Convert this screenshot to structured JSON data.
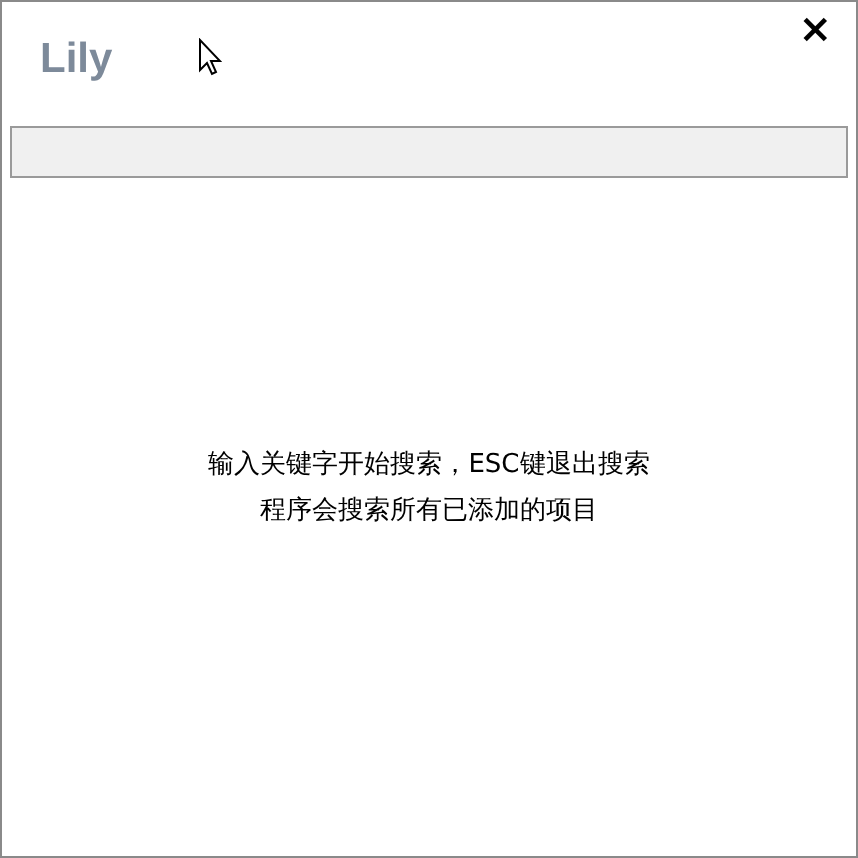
{
  "window": {
    "title": "Lily",
    "close": "×"
  },
  "hint": {
    "lines": [
      "输入关键字开始搜索，ESC键退出搜索",
      "程序会搜索所有已添加的项目"
    ]
  }
}
